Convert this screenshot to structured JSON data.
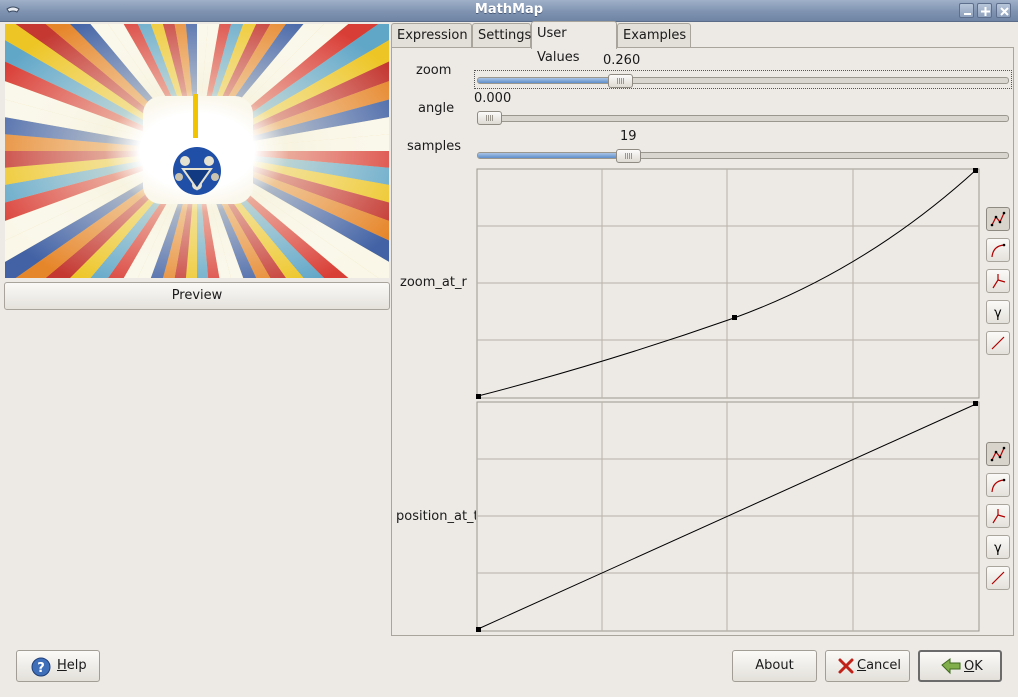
{
  "window": {
    "title": "MathMap"
  },
  "preview": {
    "button_label": "Preview"
  },
  "tabs": [
    {
      "label": "Expression",
      "active": false
    },
    {
      "label": "Settings",
      "active": false
    },
    {
      "label": "User Values",
      "active": true
    },
    {
      "label": "Examples",
      "active": false
    }
  ],
  "user_values": {
    "zoom": {
      "label": "zoom",
      "value": "0.260",
      "fraction": 0.26
    },
    "angle": {
      "label": "angle",
      "value": "0.000",
      "fraction": 0.0
    },
    "samples": {
      "label": "samples",
      "value": "19",
      "fraction": 0.28
    },
    "zoom_at_r": {
      "label": "zoom_at_r"
    },
    "position_at_t": {
      "label": "position_at_t"
    }
  },
  "curve_buttons": [
    "curve-spline-icon",
    "curve-freehand-icon",
    "curve-reset-icon",
    "gamma-icon",
    "curve-linear-icon"
  ],
  "curve_gamma_glyph": "γ",
  "buttons": {
    "help_first": "H",
    "help_rest": "elp",
    "about": "About",
    "cancel_first": "C",
    "cancel_rest": "ancel",
    "ok_first": "O",
    "ok_rest": "K"
  },
  "colors": {
    "titlebar": "#7f93b1",
    "window_bg": "#edeae6",
    "slider_fill": "#5f8fcb"
  }
}
